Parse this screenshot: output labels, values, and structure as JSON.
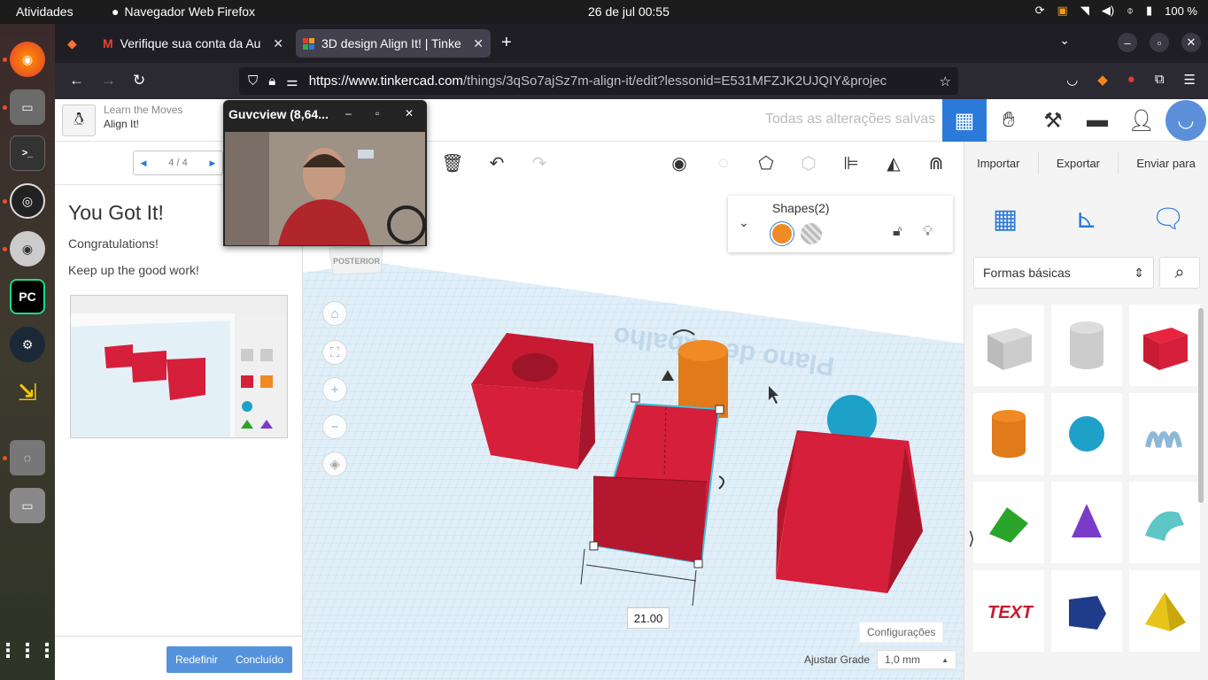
{
  "topbar": {
    "activities": "Atividades",
    "app_name": "Navegador Web Firefox",
    "clock": "26 de jul  00:55",
    "battery": "100 %"
  },
  "tabs": [
    {
      "label": "Verifique sua conta da Au",
      "icon": "gmail-icon"
    },
    {
      "label": "3D design Align It! | Tinke",
      "icon": "tinkercad-icon"
    }
  ],
  "url": {
    "host": "https://www.tinkercad.com",
    "rest": "/things/3qSo7ajSz7m-align-it/edit?lessonid=E531MFZJK2UJQIY&projec"
  },
  "lesson_header": {
    "sub": "Learn the Moves",
    "title": "Align It!"
  },
  "header": {
    "saved": "Todas as alterações salvas"
  },
  "pager": {
    "label": "4 / 4"
  },
  "lesson": {
    "title": "You Got It!",
    "p1": "Congratulations!",
    "p2": "Keep up the good work!",
    "reset": "Redefinir",
    "done": "Concluído"
  },
  "camwin": {
    "title": "Guvcview  (8,64..."
  },
  "right_tools": {
    "import": "Importar",
    "export": "Exportar",
    "send": "Enviar para"
  },
  "shapes_panel": {
    "title": "Shapes(2)"
  },
  "workplane": {
    "posterior": "POSTERIOR",
    "dimension": "21.00",
    "plane_text": "Plano de trabalho"
  },
  "settings": {
    "config": "Configurações",
    "grid_label": "Ajustar Grade",
    "grid_value": "1,0 mm"
  },
  "library": {
    "category": "Formas básicas"
  },
  "colors": {
    "accent": "#2b7ad9",
    "red": "#d61f3a",
    "orange": "#f08a24",
    "teal": "#1ea1c9"
  }
}
